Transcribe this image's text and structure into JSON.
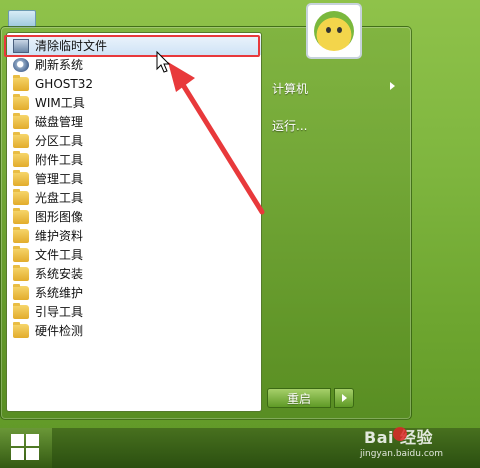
{
  "start_menu": {
    "programs": [
      {
        "label": "清除临时文件",
        "icon": "cleanup-icon",
        "highlighted": true
      },
      {
        "label": "刷新系统",
        "icon": "system-icon"
      },
      {
        "label": "GHOST32",
        "icon": "folder-icon"
      },
      {
        "label": "WIM工具",
        "icon": "folder-icon"
      },
      {
        "label": "磁盘管理",
        "icon": "folder-icon"
      },
      {
        "label": "分区工具",
        "icon": "folder-icon"
      },
      {
        "label": "附件工具",
        "icon": "folder-icon"
      },
      {
        "label": "管理工具",
        "icon": "folder-icon"
      },
      {
        "label": "光盘工具",
        "icon": "folder-icon"
      },
      {
        "label": "图形图像",
        "icon": "folder-icon"
      },
      {
        "label": "维护资料",
        "icon": "folder-icon"
      },
      {
        "label": "文件工具",
        "icon": "folder-icon"
      },
      {
        "label": "系统安装",
        "icon": "folder-icon"
      },
      {
        "label": "系统维护",
        "icon": "folder-icon"
      },
      {
        "label": "引导工具",
        "icon": "folder-icon"
      },
      {
        "label": "硬件检测",
        "icon": "folder-icon"
      }
    ],
    "right_panel": {
      "computer_label": "计算机",
      "run_label": "运行..."
    },
    "restart_label": "重启"
  },
  "watermark": {
    "brand": "Bai  经验",
    "url": "jingyan.baidu.com"
  },
  "colors": {
    "desktop": "#7fb63f",
    "highlight_border": "#e8393b",
    "annotation_arrow": "#e8393b"
  }
}
